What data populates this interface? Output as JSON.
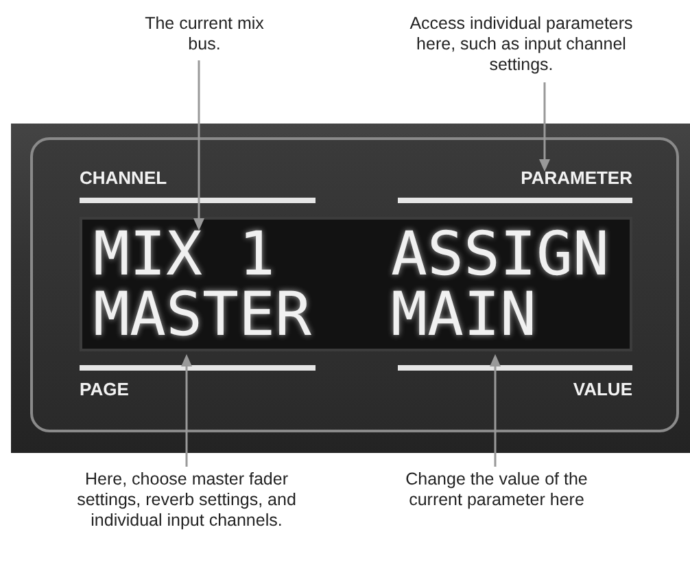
{
  "captions_top": [
    "The current mix bus.",
    "Access individual parameters here, such as input channel settings."
  ],
  "panel": {
    "labels": {
      "channel": "CHANNEL",
      "parameter": "PARAMETER",
      "page": "PAGE",
      "value": "VALUE"
    },
    "display": {
      "channel": "MIX 1",
      "parameter": "ASSIGN",
      "page": "MASTER",
      "value": "MAIN"
    }
  },
  "captions_bottom": [
    "Here, choose master fader settings, reverb settings, and individual input channels.",
    "Change the value of the current parameter here"
  ]
}
